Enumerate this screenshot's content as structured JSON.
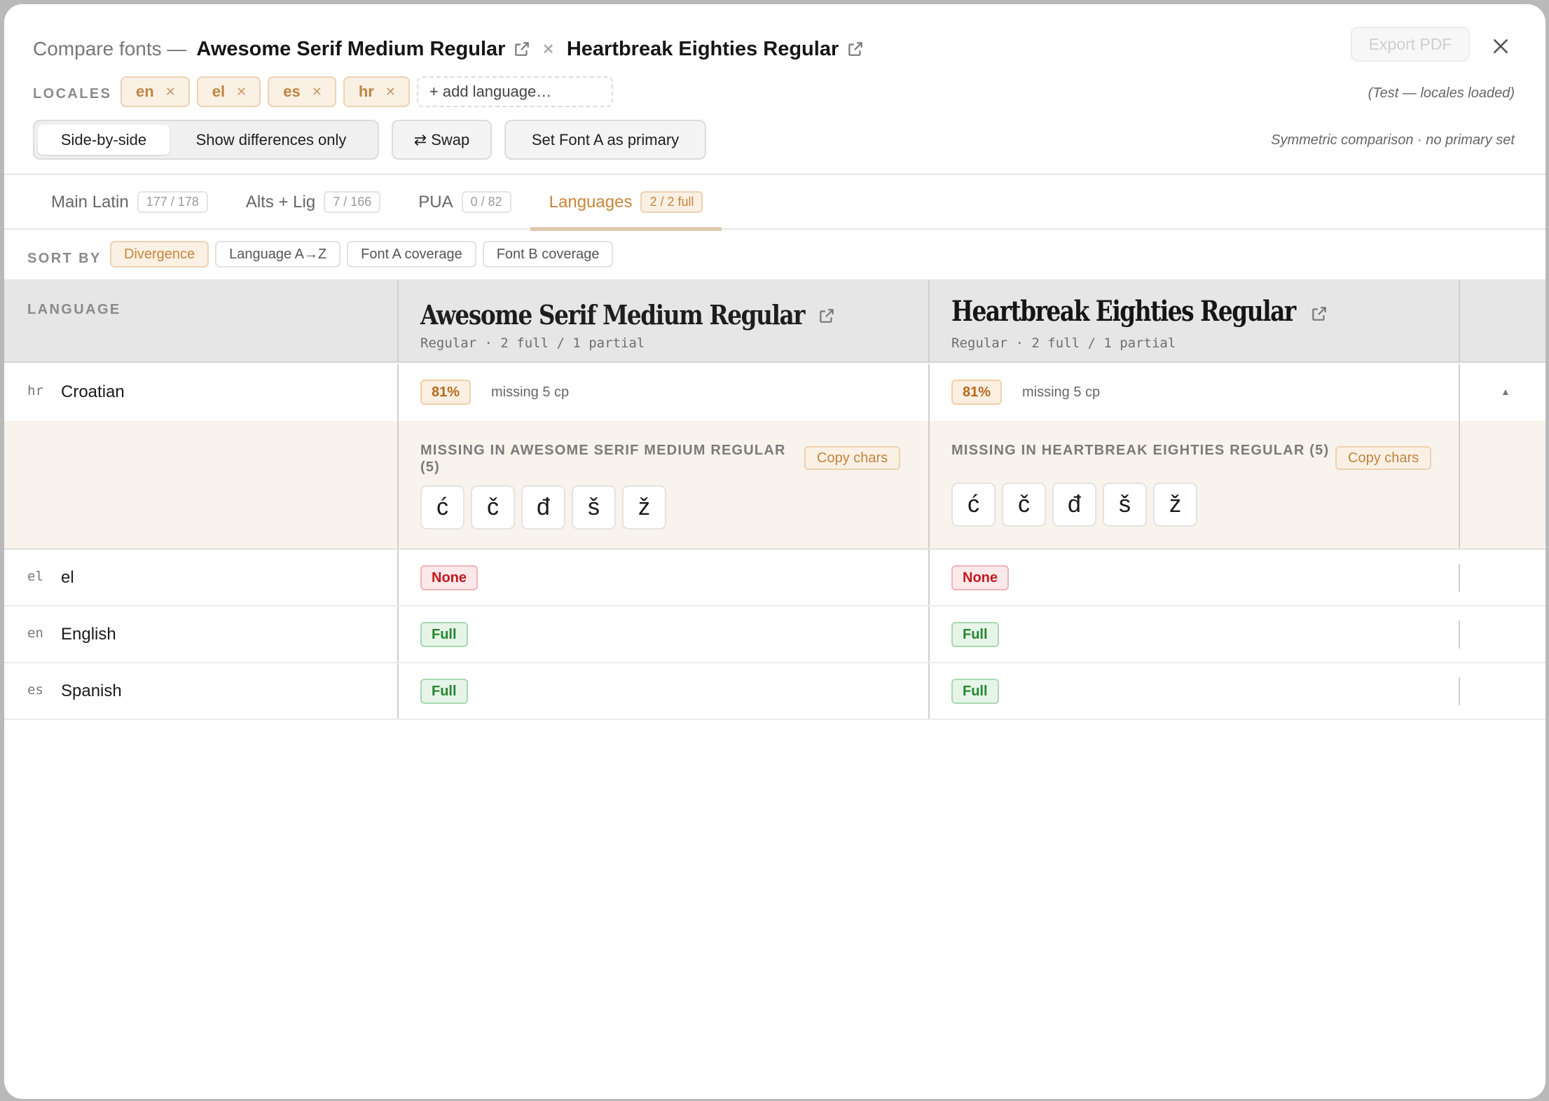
{
  "header": {
    "prefix": "Compare fonts —",
    "font_a": "Awesome Serif Medium Regular",
    "font_b": "Heartbreak Eighties Regular",
    "separator": "×",
    "export_label": "Export PDF"
  },
  "locales": {
    "label": "LOCALES",
    "chips": [
      "en",
      "el",
      "es",
      "hr"
    ],
    "add_placeholder": "+ add language…",
    "status": "(Test — locales loaded)"
  },
  "controls": {
    "view_modes": [
      "Side-by-side",
      "Show differences only"
    ],
    "active_view": "Side-by-side",
    "swap_label": "⇄ Swap",
    "primary_label": "Set Font A as primary",
    "note": "Symmetric comparison · no primary set"
  },
  "tabs": [
    {
      "label": "Main Latin",
      "count": "177 / 178"
    },
    {
      "label": "Alts + Lig",
      "count": "7 / 166"
    },
    {
      "label": "PUA",
      "count": "0 / 82"
    },
    {
      "label": "Languages",
      "count": "2 / 2 full"
    }
  ],
  "active_tab": "Languages",
  "sort": {
    "label": "SORT BY",
    "options": [
      "Divergence",
      "Language A→Z",
      "Font A coverage",
      "Font B coverage"
    ],
    "active": "Divergence"
  },
  "table": {
    "lang_header": "LANGUAGE",
    "font_a": {
      "name": "Awesome Serif Medium Regular",
      "sub": "Regular · 2 full / 1 partial"
    },
    "font_b": {
      "name": "Heartbreak Eighties Regular",
      "sub": "Regular · 2 full / 1 partial"
    },
    "rows": [
      {
        "code": "hr",
        "name": "Croatian",
        "a": "81%",
        "a_note": "missing 5 cp",
        "b": "81%",
        "b_note": "missing 5 cp",
        "caret": "▲"
      },
      {
        "code": "el",
        "name": "el",
        "a": "None",
        "b": "None"
      },
      {
        "code": "en",
        "name": "English",
        "a": "Full",
        "b": "Full"
      },
      {
        "code": "es",
        "name": "Spanish",
        "a": "Full",
        "b": "Full"
      }
    ],
    "expanded": {
      "a_heading": "MISSING IN AWESOME SERIF MEDIUM REGULAR (5)",
      "b_heading": "MISSING IN HEARTBREAK EIGHTIES REGULAR (5)",
      "copy_label": "Copy chars",
      "a_glyphs": [
        "ć",
        "č",
        "đ",
        "š",
        "ž"
      ],
      "b_glyphs": [
        "ć",
        "č",
        "đ",
        "š",
        "ž"
      ]
    }
  },
  "colors": {
    "accent": "#cd8a42",
    "full": "#23862f",
    "none": "#c3191f",
    "partial": "#b56a1d"
  }
}
